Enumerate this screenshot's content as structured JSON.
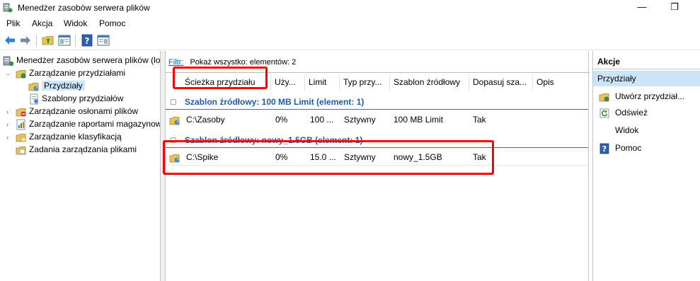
{
  "window": {
    "title": "Menedżer zasobów serwera plików",
    "minimize_glyph": "—",
    "restore_glyph": "❐"
  },
  "menu": [
    "Plik",
    "Akcja",
    "Widok",
    "Pomoc"
  ],
  "toolbar_icons": [
    "back-icon",
    "forward-icon",
    "up-folder-icon",
    "show-hide-console-tree-icon",
    "help-icon",
    "show-hide-action-pane-icon"
  ],
  "tree": {
    "root": "Menedżer zasobów serwera plików (lo",
    "quota_mgmt": "Zarządzanie przydziałami",
    "quotas": "Przydziały",
    "quota_templates": "Szablony przydziałów",
    "file_screening": "Zarządzanie osłonami plików",
    "storage_reports": "Zarządzanie raportami magazynow",
    "classification": "Zarządzanie klasyfikacją",
    "file_mgmt_tasks": "Zadania zarządzania plikami"
  },
  "filter": {
    "label": "Filtr:",
    "value": "Pokaż wszystko: elementów: 2"
  },
  "columns": [
    "Ścieżka przydziału",
    "Uży...",
    "Limit",
    "Typ przy...",
    "Szablon źródłowy",
    "Dopasuj sza...",
    "Opis"
  ],
  "groups": [
    {
      "label": "Szablon źródłowy: 100 MB Limit (element: 1)",
      "rows": [
        {
          "path": "C:\\Zasoby",
          "used": "0%",
          "limit": "100 ...",
          "type": "Sztywny",
          "template": "100 MB Limit",
          "match": "Tak",
          "desc": ""
        }
      ]
    },
    {
      "label": "Szablon źródłowy: nowy_1.5GB (element: 1)",
      "rows": [
        {
          "path": "C:\\Spike",
          "used": "0%",
          "limit": "15.0 ...",
          "type": "Sztywny",
          "template": "nowy_1.5GB",
          "match": "Tak",
          "desc": ""
        }
      ]
    }
  ],
  "actions": {
    "header": "Akcje",
    "section": "Przydziały",
    "items": [
      "Utwórz przydział...",
      "Odśwież",
      "Widok",
      "Pomoc"
    ]
  },
  "colors": {
    "selection": "#cce8ff",
    "group_text": "#1f5aa6",
    "annotation": "#ff0000"
  }
}
